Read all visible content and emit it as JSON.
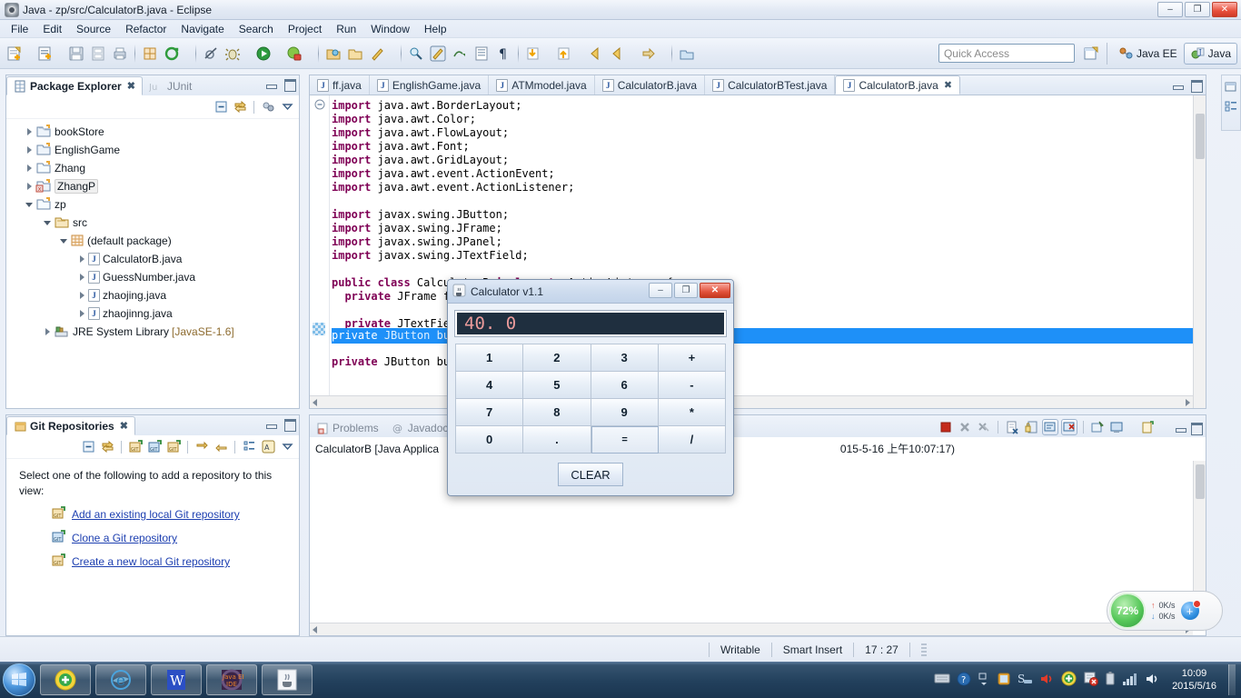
{
  "window": {
    "title": "Java - zp/src/CalculatorB.java - Eclipse",
    "icon": "eclipse-icon",
    "minimize": "–",
    "maximize": "❐",
    "close": "✕"
  },
  "menubar": {
    "items": [
      "File",
      "Edit",
      "Source",
      "Refactor",
      "Navigate",
      "Search",
      "Project",
      "Run",
      "Window",
      "Help"
    ]
  },
  "toolbar": {
    "quick_access_placeholder": "Quick Access",
    "perspectives": [
      {
        "label": "Java EE",
        "active": false
      },
      {
        "label": "Java",
        "active": true
      }
    ]
  },
  "package_explorer": {
    "tabs": [
      {
        "label": "Package Explorer",
        "active": true,
        "icon": "package-explorer-icon",
        "closeable": true
      },
      {
        "label": "JUnit",
        "active": false,
        "icon": "junit-icon",
        "closeable": false
      }
    ],
    "view_tools": [
      "collapse-all-icon",
      "link-with-editor-icon",
      "focus-icon",
      "view-menu-icon"
    ],
    "tree": [
      {
        "label": "bookStore",
        "indent": 0,
        "state": "closed",
        "icon": "java-project-icon"
      },
      {
        "label": "EnglishGame",
        "indent": 0,
        "state": "closed",
        "icon": "java-project-icon"
      },
      {
        "label": "Zhang",
        "indent": 0,
        "state": "closed",
        "icon": "project-icon"
      },
      {
        "label": "ZhangP",
        "indent": 0,
        "state": "closed",
        "icon": "java-project-error-icon",
        "selected": true
      },
      {
        "label": "zp",
        "indent": 0,
        "state": "open",
        "icon": "project-icon"
      },
      {
        "label": "src",
        "indent": 1,
        "state": "open",
        "icon": "source-folder-icon"
      },
      {
        "label": "(default package)",
        "indent": 2,
        "state": "open",
        "icon": "package-icon"
      },
      {
        "label": "CalculatorB.java",
        "indent": 3,
        "state": "closed",
        "icon": "java-file-icon"
      },
      {
        "label": "GuessNumber.java",
        "indent": 3,
        "state": "closed",
        "icon": "java-file-icon"
      },
      {
        "label": "zhaojing.java",
        "indent": 3,
        "state": "closed",
        "icon": "java-file-icon"
      },
      {
        "label": "zhaojinng.java",
        "indent": 3,
        "state": "closed",
        "icon": "java-file-icon"
      },
      {
        "label": "JRE System Library",
        "suffix": "[JavaSE-1.6]",
        "indent": 1,
        "state": "closed",
        "icon": "library-icon"
      }
    ]
  },
  "git_repositories": {
    "tab_label": "Git Repositories",
    "view_tools": [
      "collapse-all-icon",
      "link-with-selection-icon",
      "add-repo-icon",
      "clone-repo-icon",
      "create-repo-icon",
      "pull-icon",
      "push-icon",
      "hierarchy-icon",
      "sort-icon",
      "view-menu-icon"
    ],
    "intro": "Select one of the following to add a repository to this view:",
    "links": [
      {
        "label": "Add an existing local Git repository",
        "icon": "add-repo-icon"
      },
      {
        "label": "Clone a Git repository",
        "icon": "clone-repo-icon"
      },
      {
        "label": "Create a new local Git repository",
        "icon": "create-repo-icon"
      }
    ]
  },
  "editor": {
    "tabs": [
      {
        "label": "ff.java",
        "active": false
      },
      {
        "label": "EnglishGame.java",
        "active": false
      },
      {
        "label": "ATMmodel.java",
        "active": false
      },
      {
        "label": "CalculatorB.java",
        "active": false
      },
      {
        "label": "CalculatorBTest.java",
        "active": false
      },
      {
        "label": "CalculatorB.java",
        "active": true
      }
    ],
    "code_lines": [
      {
        "text": "import java.awt.BorderLayout;",
        "kw": "import",
        "fold": true
      },
      {
        "text": "import java.awt.Color;",
        "kw": "import"
      },
      {
        "text": "import java.awt.FlowLayout;",
        "kw": "import"
      },
      {
        "text": "import java.awt.Font;",
        "kw": "import"
      },
      {
        "text": "import java.awt.GridLayout;",
        "kw": "import"
      },
      {
        "text": "import java.awt.event.ActionEvent;",
        "kw": "import"
      },
      {
        "text": "import java.awt.event.ActionListener;",
        "kw": "import"
      },
      {
        "text": "",
        "kw": ""
      },
      {
        "text": "import javax.swing.JButton;",
        "kw": "import"
      },
      {
        "text": "import javax.swing.JFrame;",
        "kw": "import"
      },
      {
        "text": "import javax.swing.JPanel;",
        "kw": "import"
      },
      {
        "text": "import javax.swing.JTextField;",
        "kw": "import"
      },
      {
        "text": "",
        "kw": ""
      },
      {
        "text": "public class CalculatorB implements ActionListener {",
        "kw": "public class"
      },
      {
        "text": "  private JFrame frame;",
        "kw": "private"
      },
      {
        "text": "",
        "kw": ""
      },
      {
        "text": "  private JTextField textField;",
        "kw": "private"
      },
      {
        "text": "  private JButton button;",
        "kw": "private",
        "highlighted": true
      },
      {
        "text": "",
        "kw": ""
      },
      {
        "text": "  private JButton buttons;",
        "kw": "private"
      }
    ]
  },
  "console": {
    "tabs": [
      {
        "label": "Problems",
        "icon": "problems-icon"
      },
      {
        "label": "Javadoc",
        "icon": "javadoc-icon"
      }
    ],
    "launch_line_left": "CalculatorB [Java Applica",
    "launch_line_right": "015-5-16 上午10:07:17)",
    "tools": [
      "terminate-icon",
      "remove-launch-icon",
      "remove-all-launches-icon",
      "clear-console-icon",
      "lock-scroll-icon",
      "show-console-on-output-icon",
      "show-console-on-error-icon",
      "open-console-icon",
      "display-selected-console-icon",
      "pin-console-icon",
      "minimize-icon",
      "maximize-icon"
    ]
  },
  "calculator": {
    "title": "Calculator v1.1",
    "icon": "java-coffee-icon",
    "window_buttons": {
      "minimize": "–",
      "maximize": "❐",
      "close": "✕"
    },
    "display_value": "40. 0",
    "buttons": [
      "1",
      "2",
      "3",
      "+",
      "4",
      "5",
      "6",
      "-",
      "7",
      "8",
      "9",
      "*",
      "0",
      ".",
      "=",
      "/"
    ],
    "clear_label": "CLEAR"
  },
  "statusbar": {
    "writable": "Writable",
    "insert_mode": "Smart Insert",
    "position": "17 : 27"
  },
  "network_widget": {
    "percent": "72%",
    "upload": "0K/s",
    "download": "0K/s",
    "plus": "+"
  },
  "taskbar": {
    "start": "start-orb",
    "apps": [
      "update-icon",
      "internet-explorer-icon",
      "wps-writer-icon",
      "java-ee-ide-icon",
      "java-app-icon"
    ],
    "tray": [
      "keyboard-icon",
      "help-icon",
      "show-hidden-icon",
      "explorer-icon",
      "search-icon",
      "volume-red-icon",
      "antivirus-icon",
      "shield-error-icon",
      "battery-icon",
      "network-signal-icon",
      "speaker-icon"
    ],
    "clock_time": "10:09",
    "clock_date": "2015/5/16"
  },
  "rightbar": {
    "icons": [
      "restore-view-icon",
      "outline-icon"
    ]
  },
  "colors": {
    "accent": "#1e90f8",
    "keyword": "#7f0055",
    "link": "#1d3fb0",
    "calc_display_bg": "#1f2f3f",
    "calc_display_fg": "#eb9b9b"
  }
}
